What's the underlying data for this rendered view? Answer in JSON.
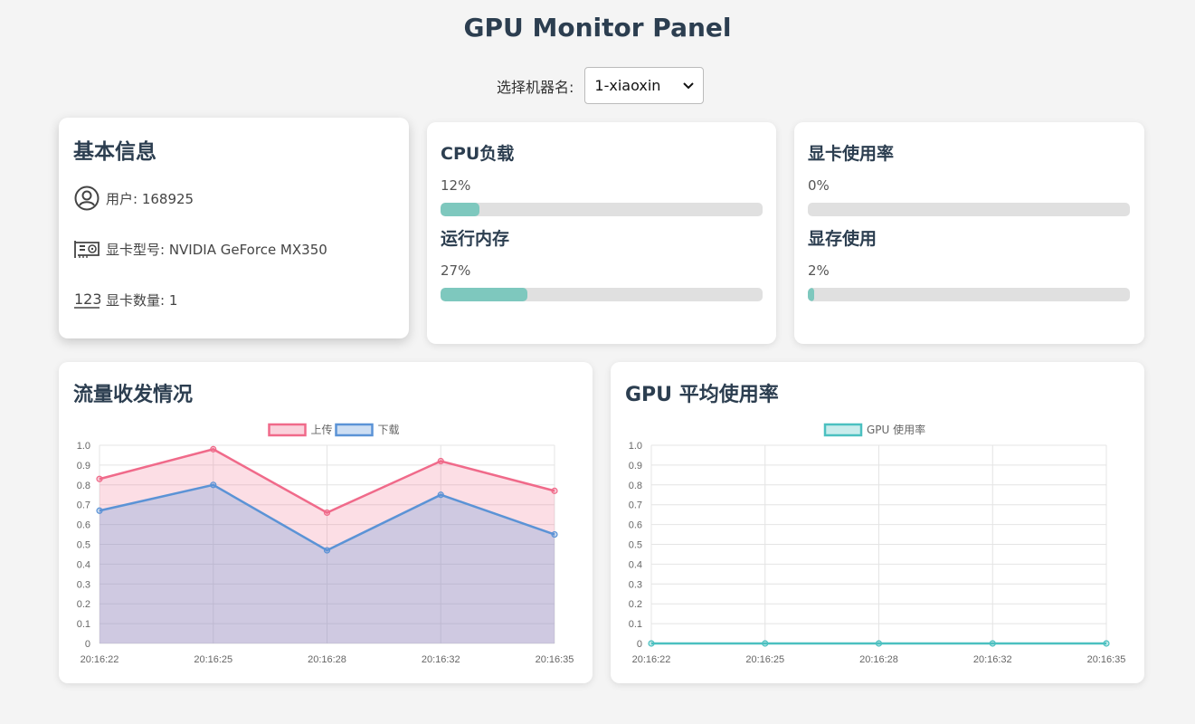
{
  "header": {
    "title": "GPU Monitor Panel"
  },
  "machine_select": {
    "label": "选择机器名:",
    "selected": "1-xiaoxin"
  },
  "basic_info": {
    "title": "基本信息",
    "rows": [
      {
        "icon": "user-icon",
        "text": "用户: 168925"
      },
      {
        "icon": "gpu-card-icon",
        "text": "显卡型号: NVIDIA GeForce MX350"
      },
      {
        "icon": "numbers-icon",
        "text": "显卡数量: 1"
      }
    ]
  },
  "cpu_card": {
    "cpu_title": "CPU负载",
    "cpu_pct": "12%",
    "cpu_value": 0.12,
    "mem_title": "运行内存",
    "mem_pct": "27%",
    "mem_value": 0.27
  },
  "gpu_card": {
    "gpu_title": "显卡使用率",
    "gpu_pct": "0%",
    "gpu_value": 0.0,
    "vram_title": "显存使用",
    "vram_pct": "2%",
    "vram_value": 0.02
  },
  "colors": {
    "bar_fill": "#7ec8be",
    "bar_track": "#e0e0e0",
    "upload": "#f06a8a",
    "download": "#5b93d6",
    "gpu": "#4bc0c0"
  },
  "chart_data": [
    {
      "type": "area",
      "title": "流量收发情况",
      "x": [
        "20:16:22",
        "20:16:25",
        "20:16:28",
        "20:16:32",
        "20:16:35"
      ],
      "ylim": [
        0,
        1.0
      ],
      "yticks": [
        "0",
        "0.1",
        "0.2",
        "0.3",
        "0.4",
        "0.5",
        "0.6",
        "0.7",
        "0.8",
        "0.9",
        "1.0"
      ],
      "legend_position": "top-center",
      "series": [
        {
          "name": "上传",
          "values": [
            0.83,
            0.98,
            0.66,
            0.92,
            0.77
          ]
        },
        {
          "name": "下载",
          "values": [
            0.67,
            0.8,
            0.47,
            0.75,
            0.55
          ]
        }
      ]
    },
    {
      "type": "line",
      "title": "GPU 平均使用率",
      "x": [
        "20:16:22",
        "20:16:25",
        "20:16:28",
        "20:16:32",
        "20:16:35"
      ],
      "ylim": [
        0,
        1.0
      ],
      "yticks": [
        "0",
        "0.1",
        "0.2",
        "0.3",
        "0.4",
        "0.5",
        "0.6",
        "0.7",
        "0.8",
        "0.9",
        "1.0"
      ],
      "legend_position": "top-center",
      "series": [
        {
          "name": "GPU 使用率",
          "values": [
            0,
            0,
            0,
            0,
            0
          ]
        }
      ]
    }
  ]
}
